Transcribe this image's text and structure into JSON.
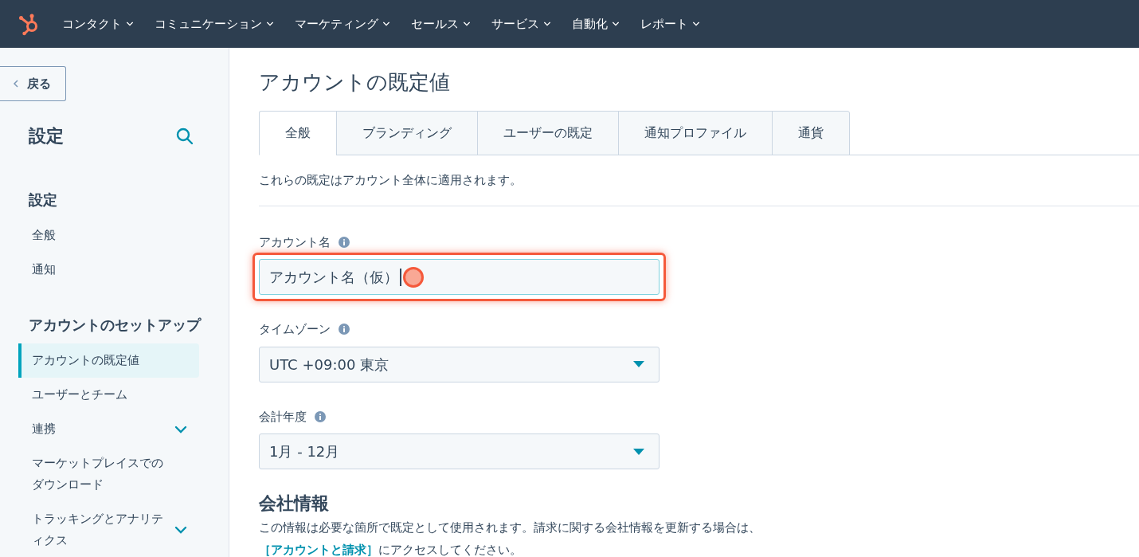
{
  "top_nav": {
    "items": [
      {
        "label": "コンタクト"
      },
      {
        "label": "コミュニケーション"
      },
      {
        "label": "マーケティング"
      },
      {
        "label": "セールス"
      },
      {
        "label": "サービス"
      },
      {
        "label": "自動化"
      },
      {
        "label": "レポート"
      }
    ]
  },
  "sidebar": {
    "back": "戻る",
    "title": "設定",
    "sections": [
      {
        "heading": "設定",
        "items": [
          {
            "label": "全般",
            "selected": false,
            "expandable": false
          },
          {
            "label": "通知",
            "selected": false,
            "expandable": false
          }
        ]
      },
      {
        "heading": "アカウントのセットアップ",
        "items": [
          {
            "label": "アカウントの既定値",
            "selected": true,
            "expandable": false
          },
          {
            "label": "ユーザーとチーム",
            "selected": false,
            "expandable": false
          },
          {
            "label": "連携",
            "selected": false,
            "expandable": true
          },
          {
            "label": "マーケットプレイスでのダウンロード",
            "selected": false,
            "expandable": false
          },
          {
            "label": "トラッキングとアナリティクス",
            "selected": false,
            "expandable": true
          }
        ]
      }
    ]
  },
  "page": {
    "title": "アカウントの既定値",
    "tabs": [
      {
        "label": "全般",
        "selected": true
      },
      {
        "label": "ブランディング",
        "selected": false
      },
      {
        "label": "ユーザーの既定",
        "selected": false
      },
      {
        "label": "通知プロファイル",
        "selected": false
      },
      {
        "label": "通貨",
        "selected": false
      }
    ],
    "description": "これらの既定はアカウント全体に適用されます。",
    "fields": [
      {
        "kind": "text",
        "label": "アカウント名",
        "value": "アカウント名（仮）",
        "highlighted": true
      },
      {
        "kind": "select",
        "label": "タイムゾーン",
        "value": "UTC +09:00 東京",
        "highlighted": false
      },
      {
        "kind": "select",
        "label": "会計年度",
        "value": "1月 - 12月",
        "highlighted": false
      }
    ],
    "company_info": {
      "heading": "会社情報",
      "text": "この情報は必要な箇所で既定として使用されます。請求に関する会社情報を更新する場合は、",
      "link": "［アカウントと請求］",
      "text_after": "にアクセスしてください。"
    }
  }
}
